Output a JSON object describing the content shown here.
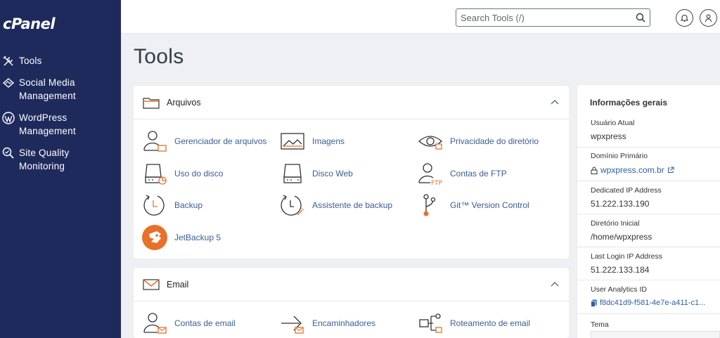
{
  "brand": {
    "logo_text": "cPanel"
  },
  "sidebar": {
    "items": [
      {
        "icon": "tools-icon",
        "label": "Tools"
      },
      {
        "icon": "social-media-icon",
        "label_line1": "Social Media",
        "label_line2": "Management"
      },
      {
        "icon": "wordpress-icon",
        "label_line1": "WordPress",
        "label_line2": "Management"
      },
      {
        "icon": "site-quality-icon",
        "label_line1": "Site Quality",
        "label_line2": "Monitoring"
      }
    ]
  },
  "header": {
    "search_placeholder": "Search Tools (/)",
    "notifications_icon": "bell-icon",
    "user_icon": "user-icon"
  },
  "page": {
    "title": "Tools"
  },
  "sections": [
    {
      "title": "Arquivos",
      "icon": "folder-icon",
      "tools": [
        {
          "label": "Gerenciador de arquivos",
          "icon": "file-manager-icon"
        },
        {
          "label": "Imagens",
          "icon": "images-icon"
        },
        {
          "label": "Privacidade do diretório",
          "icon": "directory-privacy-icon"
        },
        {
          "label": "Uso do disco",
          "icon": "disk-usage-icon"
        },
        {
          "label": "Disco Web",
          "icon": "web-disk-icon"
        },
        {
          "label": "Contas de FTP",
          "icon": "ftp-accounts-icon"
        },
        {
          "label": "Backup",
          "icon": "backup-icon"
        },
        {
          "label": "Assistente de backup",
          "icon": "backup-wizard-icon"
        },
        {
          "label": "Git™ Version Control",
          "icon": "git-icon"
        },
        {
          "label": "JetBackup 5",
          "icon": "jetbackup-icon"
        }
      ]
    },
    {
      "title": "Email",
      "icon": "envelope-icon",
      "tools": [
        {
          "label": "Contas de email",
          "icon": "email-accounts-icon"
        },
        {
          "label": "Encaminhadores",
          "icon": "forwarders-icon"
        },
        {
          "label": "Roteamento de email",
          "icon": "email-routing-icon"
        }
      ]
    }
  ],
  "info": {
    "title": "Informações gerais",
    "current_user_label": "Usuário Atual",
    "current_user": "wpxpress",
    "primary_domain_label": "Domínio Primário",
    "primary_domain": "wpxpress.com.br",
    "dedicated_ip_label": "Dedicated IP Address",
    "dedicated_ip": "51.222.133.190",
    "home_dir_label": "Diretório Inicial",
    "home_dir": "/home/wpxpress",
    "last_login_label": "Last Login IP Address",
    "last_login_ip": "51.222.133.184",
    "analytics_label": "User Analytics ID",
    "analytics_id": "f8dc41d9-f581-4e7e-a411-c1...",
    "theme_label": "Tema"
  },
  "colors": {
    "sidebar_bg": "#1f2a5c",
    "accent_orange": "#e8702a",
    "link_blue": "#3a5d94",
    "icon_gray": "#4b5563"
  }
}
